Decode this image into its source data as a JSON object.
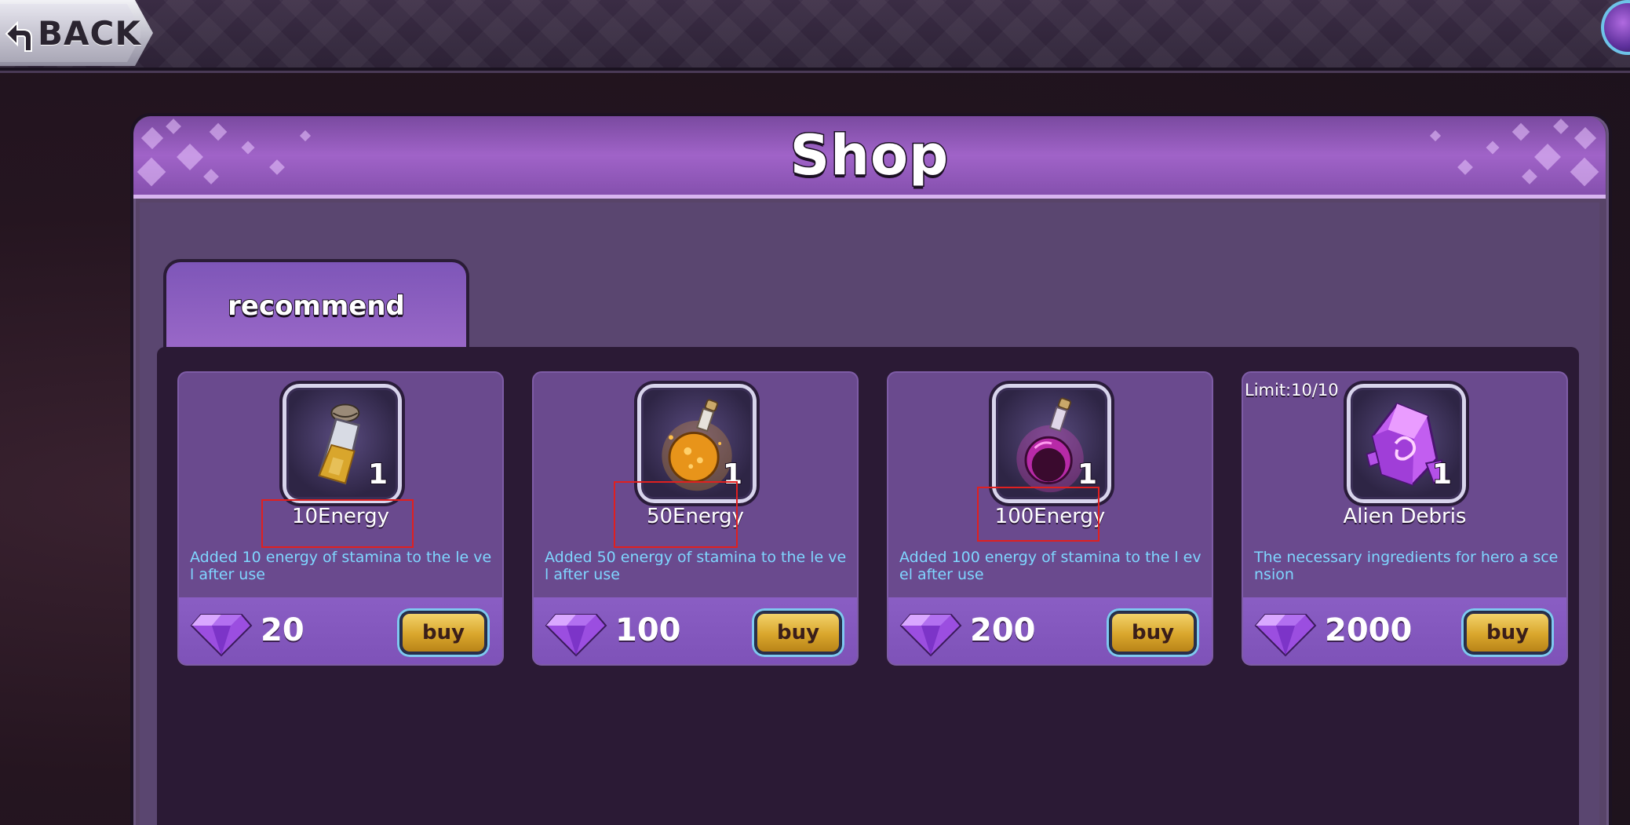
{
  "topbar": {
    "back_label": "BACK",
    "back_icon": "return-arrow-icon",
    "corner_icon": "gem-icon"
  },
  "shop": {
    "title": "Shop",
    "tabs": [
      {
        "label": "recommend",
        "selected": true
      }
    ]
  },
  "items": [
    {
      "name": "10Energy",
      "icon": "energy-potion-small-icon",
      "quantity": "1",
      "description": "Added 10 energy of stamina to the le vel after use",
      "price": "20",
      "currency_icon": "gem-icon",
      "buy_label": "buy",
      "limit": ""
    },
    {
      "name": "50Energy",
      "icon": "energy-potion-medium-icon",
      "quantity": "1",
      "description": "Added 50 energy of stamina to the le vel after use",
      "price": "100",
      "currency_icon": "gem-icon",
      "buy_label": "buy",
      "limit": ""
    },
    {
      "name": "100Energy",
      "icon": "energy-potion-large-icon",
      "quantity": "1",
      "description": "Added 100 energy of stamina to the l evel after use",
      "price": "200",
      "currency_icon": "gem-icon",
      "buy_label": "buy",
      "limit": ""
    },
    {
      "name": "Alien Debris",
      "icon": "alien-debris-crystal-icon",
      "quantity": "1",
      "description": "The necessary ingredients for hero a scension",
      "price": "2000",
      "currency_icon": "gem-icon",
      "buy_label": "buy",
      "limit": "Limit:10/10"
    }
  ],
  "colors": {
    "description_text": "#7fd6ff",
    "card_bg": "#6a4a8e",
    "buy_button": "#e0b03c",
    "highlight_box": "#e02020"
  }
}
